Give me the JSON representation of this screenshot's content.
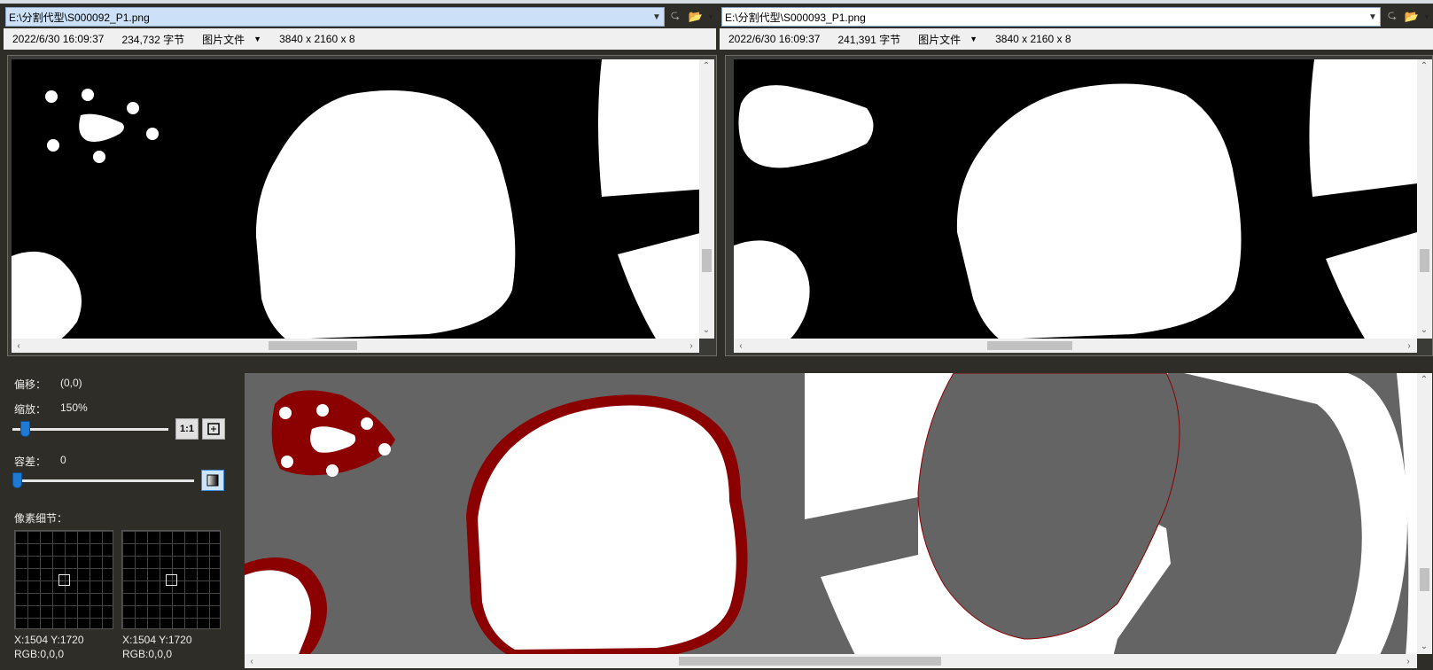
{
  "left_file": {
    "path": "E:\\分割代型\\S000092_P1.png",
    "date": "2022/6/30 16:09:37",
    "size": "234,732 字节",
    "type": "图片文件",
    "dims": "3840 x 2160 x 8"
  },
  "right_file": {
    "path": "E:\\分割代型\\S000093_P1.png",
    "date": "2022/6/30 16:09:37",
    "size": "241,391 字节",
    "type": "图片文件",
    "dims": "3840 x 2160 x 8"
  },
  "controls": {
    "offset_label": "偏移：",
    "offset_value": "(0,0)",
    "zoom_label": "缩放：",
    "zoom_value": "150%",
    "zoom_level": 0.05,
    "actual_size_label": "1:1",
    "tolerance_label": "容差：",
    "tolerance_value": "0",
    "tolerance_level": 0.0,
    "pixel_detail_label": "像素细节："
  },
  "pixel_left": {
    "coord": "X:1504 Y:1720",
    "rgb": "RGB:0,0,0"
  },
  "pixel_right": {
    "coord": "X:1504 Y:1720",
    "rgb": "RGB:0,0,0"
  },
  "colors": {
    "diff_outline": "#8b0000",
    "diff_background": "#646464",
    "accent": "#1f7ad6"
  }
}
